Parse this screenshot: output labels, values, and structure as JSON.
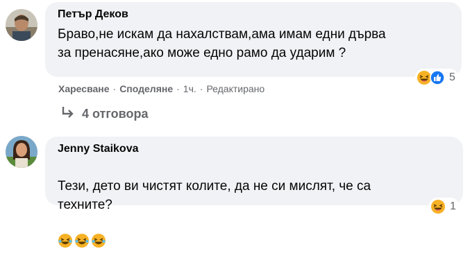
{
  "comments": [
    {
      "author": "Петър Деков",
      "text": "Браво,не искам да нахалствам,ама имам едни дърва\nза пренасяне,ако може едно рамо да ударим ?",
      "reaction_count": "5",
      "reaction_icons": [
        "laugh-emoji-icon",
        "like-icon"
      ]
    },
    {
      "author": "Jenny Staikova",
      "text": "Тези, дето ви чистят колите, да не си мислят, че са\nтехните?",
      "inline_emojis": [
        "laugh-emoji-icon",
        "laugh-emoji-icon",
        "laugh-emoji-icon"
      ],
      "reaction_count": "1",
      "reaction_icons": [
        "laugh-emoji-icon"
      ]
    }
  ],
  "actions": {
    "like": "Харесване",
    "dot1": "·",
    "share": "Споделяне",
    "dot2": "·",
    "time": "1ч.",
    "dot3": "·",
    "edited": "Редактирано"
  },
  "replies": {
    "label": "4 отговора",
    "arrow_icon": "reply-arrow-icon"
  },
  "colors": {
    "bubble": "#f0f2f5",
    "meta_text": "#65676b",
    "like_blue": "#1877f2",
    "laugh_yellow": "#f7b125"
  }
}
